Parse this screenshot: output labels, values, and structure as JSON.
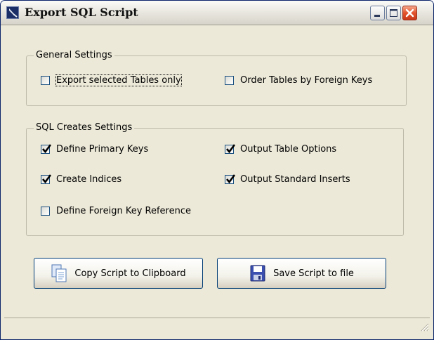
{
  "window": {
    "title": "Export SQL Script",
    "controls": {
      "minimize": "minimize",
      "maximize": "maximize",
      "close": "close"
    }
  },
  "general": {
    "title": "General Settings",
    "export_selected": {
      "label": "Export selected Tables only",
      "checked": false
    },
    "order_by_fk": {
      "label": "Order Tables by Foreign Keys",
      "checked": false
    }
  },
  "creates": {
    "title": "SQL Creates Settings",
    "define_pk": {
      "label": "Define Primary Keys",
      "checked": true
    },
    "create_indices": {
      "label": "Create Indices",
      "checked": true
    },
    "define_fk": {
      "label": "Define Foreign Key Reference",
      "checked": false
    },
    "table_options": {
      "label": "Output Table Options",
      "checked": true
    },
    "standard_inserts": {
      "label": "Output Standard Inserts",
      "checked": true
    }
  },
  "buttons": {
    "copy": {
      "label": "Copy Script to Clipboard",
      "icon": "copy-icon"
    },
    "save": {
      "label": "Save Script to file",
      "icon": "floppy-disk-icon"
    }
  },
  "colors": {
    "face": "#ece9d8",
    "accent": "#1c5180",
    "close": "#e2522c"
  }
}
